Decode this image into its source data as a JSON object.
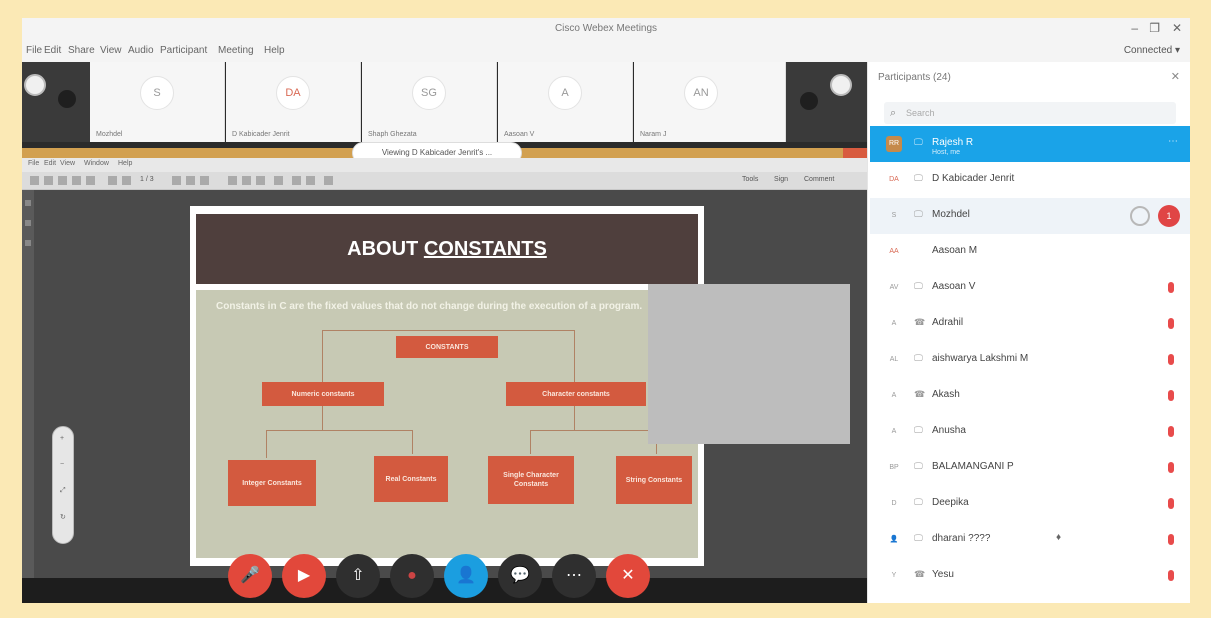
{
  "window": {
    "title": "Cisco Webex Meetings",
    "minimize": "–",
    "maximize": "❐",
    "close": "✕"
  },
  "menu": {
    "items": [
      "File",
      "Edit",
      "Share",
      "View",
      "Audio",
      "Participant",
      "Meeting",
      "Help"
    ],
    "connected": "Connected ▾"
  },
  "thumbnails": [
    {
      "initials": "S",
      "name": "Mozhdel"
    },
    {
      "initials": "DA",
      "name": "D Kabicader Jenrit"
    },
    {
      "initials": "SG",
      "name": "Shaph Ghezata"
    },
    {
      "initials": "A",
      "name": "Aasoan V"
    },
    {
      "initials": "AN",
      "name": "Naram J"
    }
  ],
  "viewer": {
    "share_label": "Viewing D Kabicader Jenrit's ...",
    "menu": [
      "File",
      "Edit",
      "View",
      "Window",
      "Help"
    ],
    "tools": "Tools",
    "sign": "Sign",
    "comment": "Comment",
    "page": "1 / 3",
    "zoom_labels": [
      "+",
      "−",
      "⤢",
      "↻"
    ]
  },
  "slide": {
    "title_plain": "ABOUT ",
    "title_underlined": "CONSTANTS",
    "bullet": "Constants in C are the fixed values that do not change during the execution of a program.",
    "root": "CONSTANTS",
    "level1": [
      "Numeric constants",
      "Character constants"
    ],
    "level2": [
      "Integer Constants",
      "Real Constants",
      "Single Character Constants",
      "String Constants"
    ]
  },
  "controls": {
    "mute": "🎤",
    "video": "▶",
    "share": "⇧",
    "record": "●",
    "participants": "👤",
    "chat": "💬",
    "more": "⋯",
    "leave": "✕"
  },
  "panel": {
    "title": "Participants (24)",
    "close": "✕",
    "search_placeholder": "Search",
    "search_icon": "search-icon",
    "participants": [
      {
        "name": "Rajesh R",
        "sub": "Host, me",
        "avatar": "RR",
        "icon": "🖵",
        "state": "selected"
      },
      {
        "name": "D Kabicader Jenrit",
        "sub": "",
        "avatar": "DA",
        "icon": "🖵",
        "state": "normal"
      },
      {
        "name": "Mozhdel",
        "sub": "",
        "avatar": "S",
        "icon": "🖵",
        "state": "hovered",
        "badge": "1"
      },
      {
        "name": "Aasoan M",
        "sub": "",
        "avatar": "AA",
        "icon": "",
        "state": "normal"
      },
      {
        "name": "Aasoan V",
        "sub": "",
        "avatar": "AV",
        "icon": "🖵",
        "state": "muted"
      },
      {
        "name": "Adrahil",
        "sub": "",
        "avatar": "A",
        "icon": "☎",
        "state": "muted"
      },
      {
        "name": "aishwarya Lakshmi M",
        "sub": "",
        "avatar": "AL",
        "icon": "🖵",
        "state": "muted"
      },
      {
        "name": "Akash",
        "sub": "",
        "avatar": "A",
        "icon": "☎",
        "state": "muted"
      },
      {
        "name": "Anusha",
        "sub": "",
        "avatar": "A",
        "icon": "🖵",
        "state": "muted"
      },
      {
        "name": "BALAMANGANI P",
        "sub": "",
        "avatar": "BP",
        "icon": "🖵",
        "state": "muted"
      },
      {
        "name": "Deepika",
        "sub": "",
        "avatar": "D",
        "icon": "🖵",
        "state": "muted"
      },
      {
        "name": "dharani ????",
        "sub": "",
        "avatar": "👤",
        "icon": "🖵",
        "state": "muted",
        "extra": "♦"
      },
      {
        "name": "Yesu",
        "sub": "",
        "avatar": "Y",
        "icon": "☎",
        "state": "muted"
      }
    ]
  }
}
